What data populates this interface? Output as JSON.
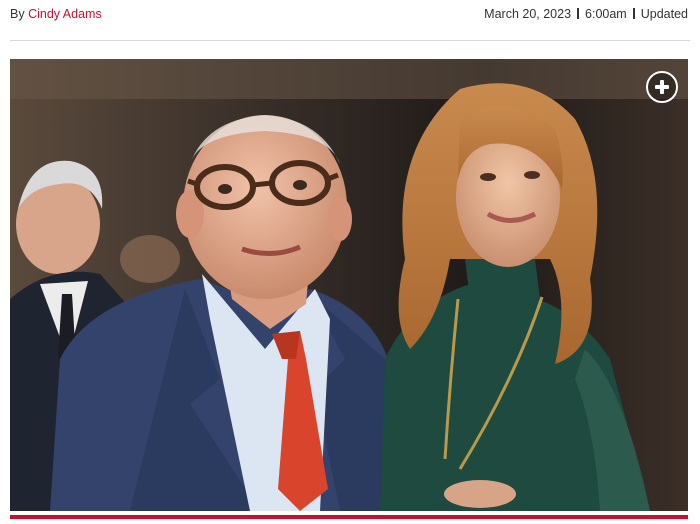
{
  "byline": {
    "prefix": "By ",
    "author": "Cindy Adams"
  },
  "dateline": {
    "date": "March 20, 2023",
    "time": "6:00am",
    "updated_label": "Updated"
  },
  "photo": {
    "expand_icon": "plus-circle-icon"
  },
  "colors": {
    "accent": "#c8102e",
    "text": "#333333"
  }
}
